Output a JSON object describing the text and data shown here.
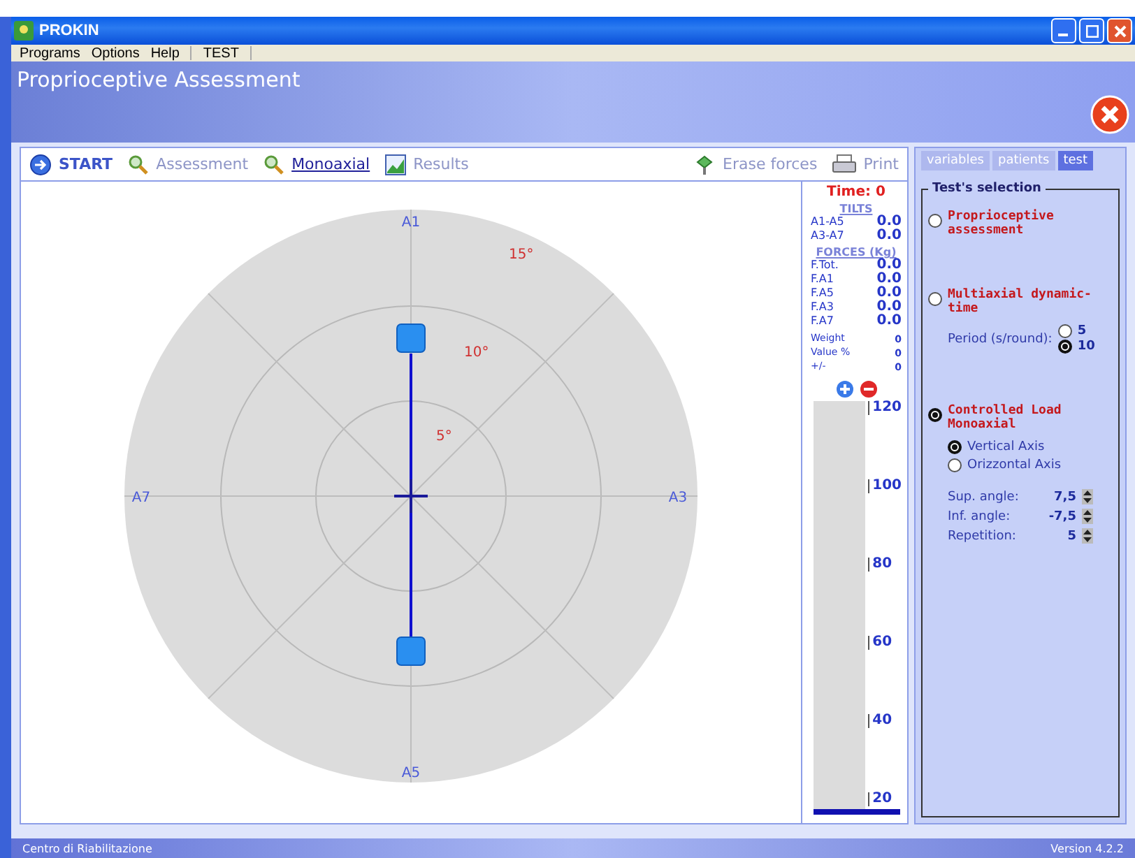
{
  "window": {
    "title": "PROKIN"
  },
  "menu": [
    {
      "label": "Programs"
    },
    {
      "label": "Options"
    },
    {
      "label": "Help"
    },
    {
      "label": "TEST"
    }
  ],
  "header": {
    "title": "Proprioceptive Assessment"
  },
  "toolbar": {
    "left": [
      {
        "label": "START",
        "kind": "start",
        "selected": false
      },
      {
        "label": "Assessment",
        "kind": "assess",
        "selected": false
      },
      {
        "label": "Monoaxial",
        "kind": "assess",
        "selected": true
      },
      {
        "label": "Results",
        "kind": "chart",
        "selected": false
      }
    ],
    "right": [
      {
        "label": "Erase forces",
        "kind": "erase"
      },
      {
        "label": "Print",
        "kind": "print"
      }
    ]
  },
  "plot": {
    "axis_labels": [
      "A1",
      "A3",
      "A5",
      "A7"
    ],
    "ring_labels": [
      "5°",
      "10°",
      "15°"
    ]
  },
  "readout": {
    "time": "Time: 0",
    "tilts_heading": "TILTS",
    "tilts": [
      {
        "label": "A1-A5",
        "value": "0.0"
      },
      {
        "label": "A3-A7",
        "value": "0.0"
      }
    ],
    "forces_heading": "FORCES (Kg)",
    "forces": [
      {
        "label": "F.Tot.",
        "value": "0.0"
      },
      {
        "label": "F.A1",
        "value": "0.0"
      },
      {
        "label": "F.A5",
        "value": "0.0"
      },
      {
        "label": "F.A3",
        "value": "0.0"
      },
      {
        "label": "F.A7",
        "value": "0.0"
      }
    ],
    "weights": [
      {
        "label": "Weight",
        "value": "0"
      },
      {
        "label": "Value %",
        "value": "0"
      },
      {
        "label": "+/-",
        "value": "0"
      }
    ]
  },
  "gauge": {
    "level": 0.015,
    "ticks": [
      "120",
      "100",
      "80",
      "60",
      "40",
      "20"
    ]
  },
  "side_tabs": [
    {
      "label": "variables",
      "selected": false
    },
    {
      "label": "patients",
      "selected": false
    },
    {
      "label": "test",
      "selected": true
    }
  ],
  "test_selection": {
    "title": "Test's selection",
    "options": [
      {
        "label": "Proprioceptive assessment",
        "selected": false
      },
      {
        "label": "Multiaxial dynamic-time",
        "selected": false,
        "period_label": "Period (s/round):",
        "periods": [
          {
            "label": "5",
            "selected": false
          },
          {
            "label": "10",
            "selected": true
          }
        ]
      },
      {
        "label": "Controlled Load Monoaxial",
        "selected": true,
        "axes": [
          {
            "label": "Vertical Axis",
            "selected": true
          },
          {
            "label": "Orizzontal Axis",
            "selected": false
          }
        ],
        "params": [
          {
            "label": "Sup. angle:",
            "value": "7,5"
          },
          {
            "label": "Inf. angle:",
            "value": "-7,5"
          },
          {
            "label": "Repetition:",
            "value": "5"
          }
        ]
      }
    ]
  },
  "status_bar": {
    "left": "Centro di Riabilitazione",
    "right": "Version 4.2.2"
  }
}
